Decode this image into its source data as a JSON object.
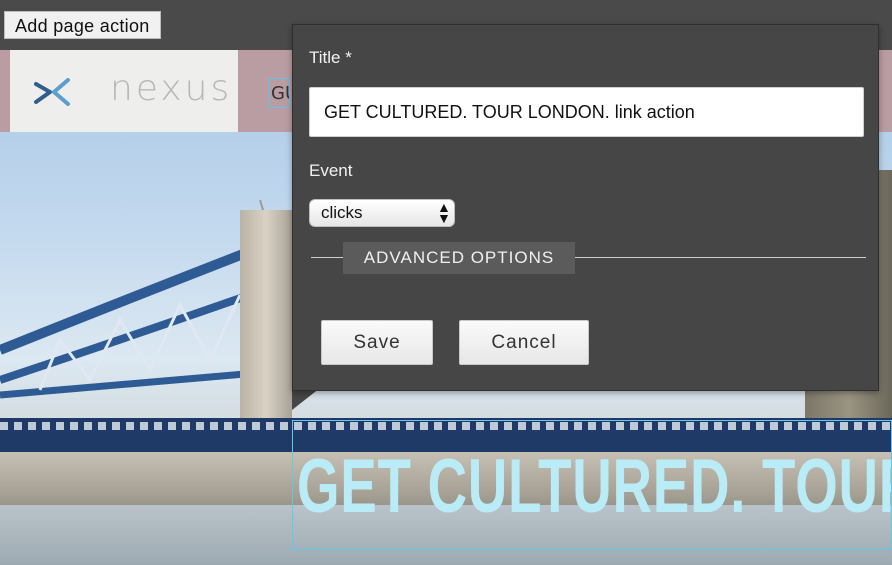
{
  "toolbar": {
    "add_page_action_label": "Add page action"
  },
  "site": {
    "logo_text": "nexus",
    "nav_peek_text": "GU",
    "headline": "GET CULTURED. TOUR LONDON."
  },
  "dialog": {
    "title_label": "Title *",
    "title_value": "GET CULTURED. TOUR LONDON. link action",
    "event_label": "Event",
    "event_selected": "clicks",
    "advanced_options_label": "ADVANCED OPTIONS",
    "save_label": "Save",
    "cancel_label": "Cancel"
  },
  "icons": {
    "logo": "nexus-logo-icon",
    "select_arrows": "updown-arrows-icon"
  },
  "colors": {
    "dialog_bg": "#464646",
    "legend_bg": "#5b5b5b",
    "header_bg": "#b99da2",
    "headline_text": "#b9ecf6",
    "selection_outline": "#5fc9ea"
  }
}
